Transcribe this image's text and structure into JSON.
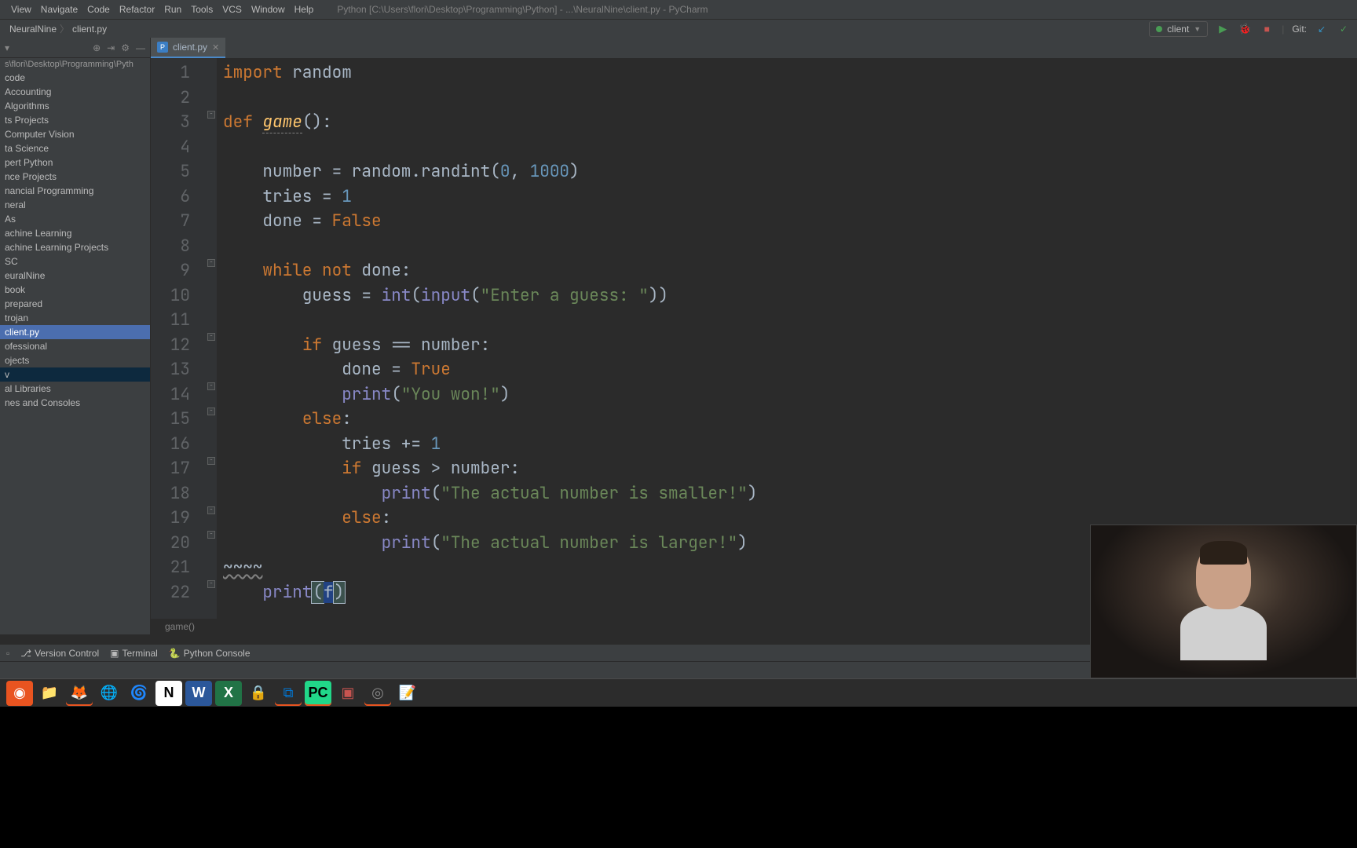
{
  "window": {
    "title": "Python [C:\\Users\\flori\\Desktop\\Programming\\Python] - ...\\NeuralNine\\client.py - PyCharm"
  },
  "menu": {
    "items": [
      "View",
      "Navigate",
      "Code",
      "Refactor",
      "Run",
      "Tools",
      "VCS",
      "Window",
      "Help"
    ]
  },
  "breadcrumb": {
    "parts": [
      "NeuralNine",
      "client.py"
    ]
  },
  "run_config": {
    "name": "client",
    "git_label": "Git:"
  },
  "sidebar": {
    "root_path": "s\\flori\\Desktop\\Programming\\Pyth",
    "items": [
      "code",
      "Accounting",
      "Algorithms",
      "ts Projects",
      "Computer Vision",
      "ta Science",
      "pert Python",
      "nce Projects",
      "nancial Programming",
      "neral",
      "As",
      "achine Learning",
      "achine Learning Projects",
      "SC",
      "euralNine",
      "book",
      "prepared",
      "trojan",
      "client.py",
      "ofessional",
      "ojects",
      "v",
      "al Libraries",
      "nes and Consoles"
    ],
    "selected_index": 18,
    "highlighted_index": 21
  },
  "tab": {
    "filename": "client.py"
  },
  "code": {
    "lines": [
      {
        "n": 1,
        "tokens": [
          {
            "t": "import ",
            "c": "kw"
          },
          {
            "t": "random",
            "c": ""
          }
        ]
      },
      {
        "n": 2,
        "tokens": []
      },
      {
        "n": 3,
        "tokens": [
          {
            "t": "def ",
            "c": "kw"
          },
          {
            "t": "game",
            "c": "fn-def"
          },
          {
            "t": "():",
            "c": ""
          }
        ]
      },
      {
        "n": 4,
        "tokens": []
      },
      {
        "n": 5,
        "tokens": [
          {
            "t": "    number = random.randint(",
            "c": ""
          },
          {
            "t": "0",
            "c": "num"
          },
          {
            "t": ", ",
            "c": ""
          },
          {
            "t": "1000",
            "c": "num"
          },
          {
            "t": ")",
            "c": ""
          }
        ]
      },
      {
        "n": 6,
        "tokens": [
          {
            "t": "    tries = ",
            "c": ""
          },
          {
            "t": "1",
            "c": "num"
          }
        ]
      },
      {
        "n": 7,
        "tokens": [
          {
            "t": "    done = ",
            "c": ""
          },
          {
            "t": "False",
            "c": "kw"
          }
        ]
      },
      {
        "n": 8,
        "tokens": []
      },
      {
        "n": 9,
        "tokens": [
          {
            "t": "    ",
            "c": ""
          },
          {
            "t": "while not ",
            "c": "kw"
          },
          {
            "t": "done:",
            "c": ""
          }
        ]
      },
      {
        "n": 10,
        "tokens": [
          {
            "t": "        guess = ",
            "c": ""
          },
          {
            "t": "int",
            "c": "builtin"
          },
          {
            "t": "(",
            "c": ""
          },
          {
            "t": "input",
            "c": "builtin"
          },
          {
            "t": "(",
            "c": ""
          },
          {
            "t": "\"Enter a guess: \"",
            "c": "str"
          },
          {
            "t": "))",
            "c": ""
          }
        ]
      },
      {
        "n": 11,
        "tokens": []
      },
      {
        "n": 12,
        "tokens": [
          {
            "t": "        ",
            "c": ""
          },
          {
            "t": "if ",
            "c": "kw"
          },
          {
            "t": "guess == number:",
            "c": ""
          }
        ]
      },
      {
        "n": 13,
        "tokens": [
          {
            "t": "            done = ",
            "c": ""
          },
          {
            "t": "True",
            "c": "kw"
          }
        ]
      },
      {
        "n": 14,
        "tokens": [
          {
            "t": "            ",
            "c": ""
          },
          {
            "t": "print",
            "c": "builtin"
          },
          {
            "t": "(",
            "c": ""
          },
          {
            "t": "\"You won!\"",
            "c": "str"
          },
          {
            "t": ")",
            "c": ""
          }
        ]
      },
      {
        "n": 15,
        "tokens": [
          {
            "t": "        ",
            "c": ""
          },
          {
            "t": "else",
            "c": "kw"
          },
          {
            "t": ":",
            "c": ""
          }
        ]
      },
      {
        "n": 16,
        "tokens": [
          {
            "t": "            tries += ",
            "c": ""
          },
          {
            "t": "1",
            "c": "num"
          }
        ]
      },
      {
        "n": 17,
        "tokens": [
          {
            "t": "            ",
            "c": ""
          },
          {
            "t": "if ",
            "c": "kw"
          },
          {
            "t": "guess > number:",
            "c": ""
          }
        ]
      },
      {
        "n": 18,
        "tokens": [
          {
            "t": "                ",
            "c": ""
          },
          {
            "t": "print",
            "c": "builtin"
          },
          {
            "t": "(",
            "c": ""
          },
          {
            "t": "\"The actual number is smaller!\"",
            "c": "str"
          },
          {
            "t": ")",
            "c": ""
          }
        ]
      },
      {
        "n": 19,
        "tokens": [
          {
            "t": "            ",
            "c": ""
          },
          {
            "t": "else",
            "c": "kw"
          },
          {
            "t": ":",
            "c": ""
          }
        ]
      },
      {
        "n": 20,
        "tokens": [
          {
            "t": "                ",
            "c": ""
          },
          {
            "t": "print",
            "c": "builtin"
          },
          {
            "t": "(",
            "c": ""
          },
          {
            "t": "\"The actual number is larger!\"",
            "c": "str"
          },
          {
            "t": ")",
            "c": ""
          }
        ]
      },
      {
        "n": 21,
        "tokens": [
          {
            "t": "~~~~",
            "c": "wavy"
          }
        ]
      },
      {
        "n": 22,
        "tokens": [
          {
            "t": "    ",
            "c": ""
          },
          {
            "t": "print",
            "c": "builtin"
          },
          {
            "t": "(",
            "c": "paren-active"
          },
          {
            "t": "f",
            "c": "caret"
          },
          {
            "t": ")",
            "c": "paren-active"
          }
        ]
      }
    ]
  },
  "breadcrumb_bottom": "game()",
  "bottom_tools": {
    "version_control": "Version Control",
    "terminal": "Terminal",
    "python_console": "Python Console"
  },
  "taskbar": {
    "icons": [
      "ubuntu",
      "files",
      "firefox",
      "chrome",
      "edge",
      "notion",
      "word",
      "excel",
      "security",
      "vscode",
      "pycharm",
      "app1",
      "obs",
      "app2"
    ]
  }
}
